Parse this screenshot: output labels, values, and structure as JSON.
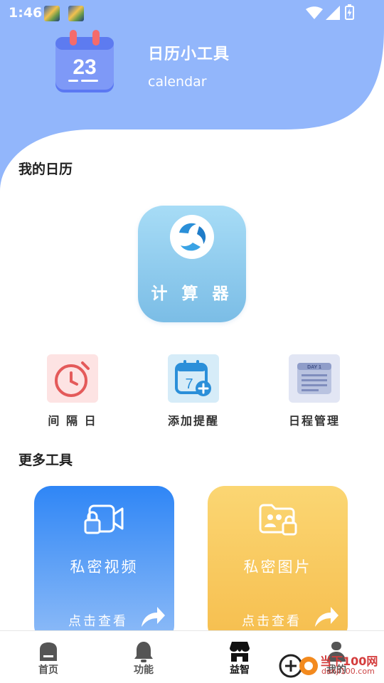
{
  "status_bar": {
    "time": "1:46",
    "notification_icons": [
      "notification-picture-icon",
      "notification-picture-icon"
    ],
    "right_icons": [
      "wifi-icon",
      "signal-icon",
      "battery-charging-icon"
    ]
  },
  "header": {
    "app_icon_number": "23",
    "title": "日历小工具",
    "subtitle": "calendar",
    "colors": {
      "hero_blue": "#92b6fb",
      "icon_blue": "#5b78f2"
    }
  },
  "my_calendar": {
    "title": "我的日历",
    "main_tool": {
      "label": "计 算 器",
      "icon": "calculator-swirl-icon"
    },
    "tools": [
      {
        "label": "间 隔 日",
        "icon": "timer-icon",
        "bg": "#fde3e3"
      },
      {
        "label": "添加提醒",
        "icon": "calendar-add-icon",
        "bg": "#d6ecf8"
      },
      {
        "label": "日程管理",
        "icon": "day-planner-icon",
        "bg": "#e2e6f4",
        "badge": "DAY 1"
      }
    ]
  },
  "more_tools": {
    "title": "更多工具",
    "cards": [
      {
        "title": "私密视频",
        "action": "点击查看",
        "icon": "locked-video-icon",
        "colors": [
          "#2f86f6",
          "#8fbcf7"
        ]
      },
      {
        "title": "私密图片",
        "action": "点击查看",
        "icon": "locked-photo-folder-icon",
        "colors": [
          "#fbd673",
          "#f6be4e"
        ]
      }
    ]
  },
  "bottom_nav": {
    "items": [
      {
        "label": "首页",
        "icon": "home-icon",
        "active": false
      },
      {
        "label": "功能",
        "icon": "bell-icon",
        "active": false
      },
      {
        "label": "益智",
        "icon": "store-icon",
        "active": true
      },
      {
        "label": "我的",
        "icon": "profile-icon",
        "active": false
      }
    ]
  },
  "watermark": {
    "name": "当下100网",
    "url": "danji100.com"
  }
}
